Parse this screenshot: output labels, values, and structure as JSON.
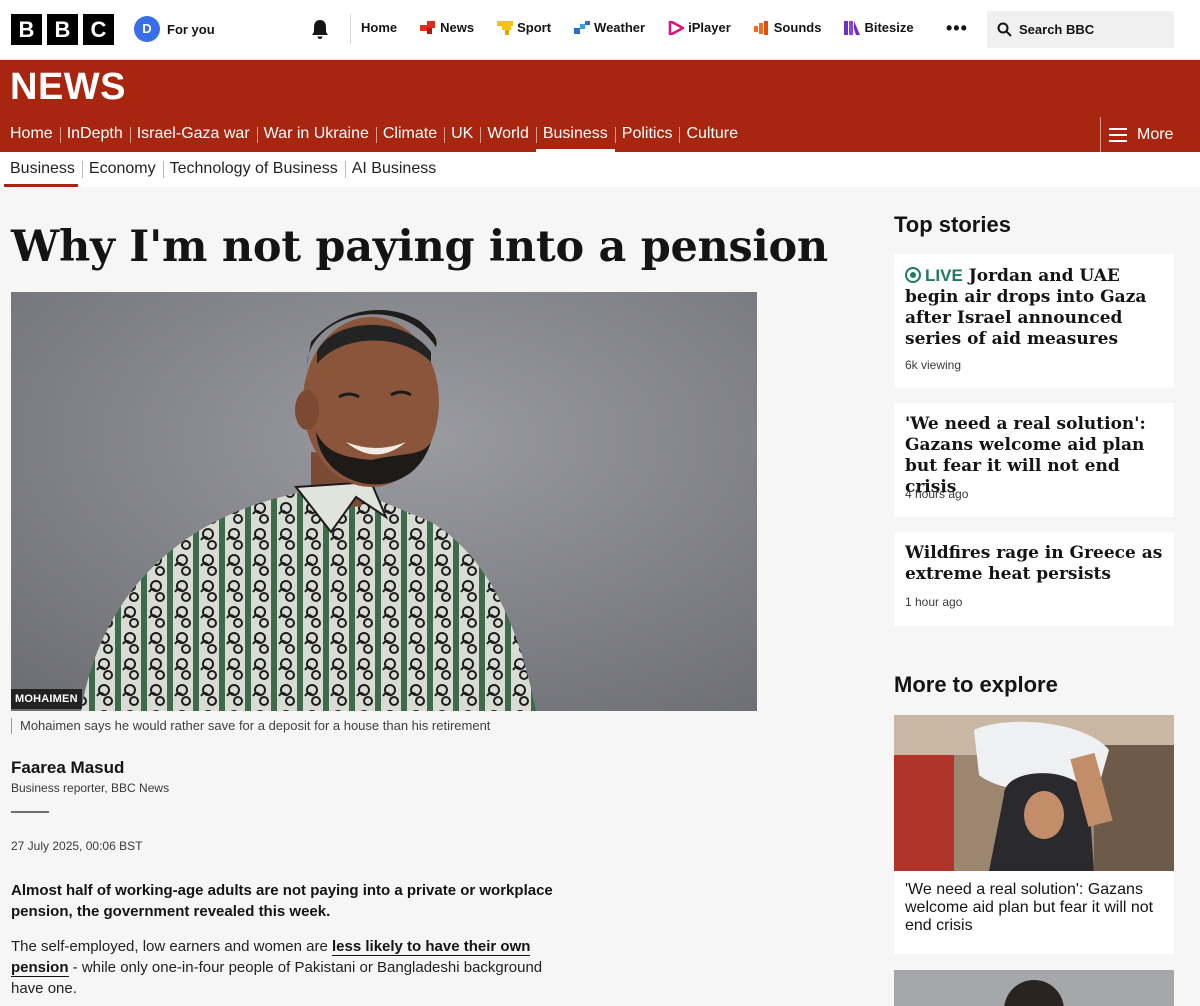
{
  "masthead": {
    "logo_letters": [
      "B",
      "B",
      "C"
    ],
    "avatar_initial": "D",
    "for_you_label": "For you",
    "nav": [
      {
        "label": "Home",
        "icon": "none"
      },
      {
        "label": "News",
        "icon": "news-icon"
      },
      {
        "label": "Sport",
        "icon": "sport-icon"
      },
      {
        "label": "Weather",
        "icon": "weather-icon"
      },
      {
        "label": "iPlayer",
        "icon": "iplayer-icon"
      },
      {
        "label": "Sounds",
        "icon": "sounds-icon"
      },
      {
        "label": "Bitesize",
        "icon": "bitesize-icon"
      }
    ],
    "more_dots": "•••",
    "search_label": "Search BBC"
  },
  "banner": {
    "title": "NEWS",
    "nav": [
      "Home",
      "InDepth",
      "Israel-Gaza war",
      "War in Ukraine",
      "Climate",
      "UK",
      "World",
      "Business",
      "Politics",
      "Culture"
    ],
    "active": "Business",
    "more_label": "More",
    "color": "#a8260f"
  },
  "subnav": {
    "items": [
      "Business",
      "Economy",
      "Technology of Business",
      "AI Business"
    ],
    "active": "Business"
  },
  "article": {
    "headline": "Why I'm not paying into a pension",
    "photo_credit": "MOHAIMEN",
    "caption": "Mohaimen says he would rather save for a deposit for a house than his retirement",
    "author": "Faarea Masud",
    "role": "Business reporter, BBC News",
    "date": "27 July 2025, 00:06 BST",
    "lede": "Almost half of working-age adults are not paying into a private or workplace pension, the government revealed this week.",
    "para_before": "The self-employed, low earners and women are ",
    "para_link": "less likely to have their own pension",
    "para_after": " - while only one-in-four people of Pakistani or Bangladeshi background have one."
  },
  "sidebar": {
    "top_stories_heading": "Top stories",
    "stories": [
      {
        "live": "LIVE",
        "title": "Jordan and UAE begin air drops into Gaza after Israel announced series of aid measures",
        "meta": "6k viewing"
      },
      {
        "live": "",
        "title": "'We need a real solution': Gazans welcome aid plan but fear it will not end crisis",
        "meta": "4 hours ago"
      },
      {
        "live": "",
        "title": "Wildfires rage in Greece as extreme heat persists",
        "meta": "1 hour ago"
      }
    ],
    "explore_heading": "More to explore",
    "explore": [
      {
        "title": "'We need a real solution': Gazans welcome aid plan but fear it will not end crisis"
      }
    ]
  }
}
